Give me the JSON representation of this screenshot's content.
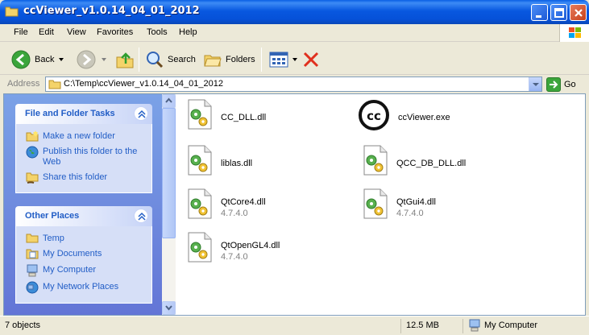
{
  "window": {
    "title": "ccViewer_v1.0.14_04_01_2012"
  },
  "menu": [
    "File",
    "Edit",
    "View",
    "Favorites",
    "Tools",
    "Help"
  ],
  "toolbar": {
    "back": "Back",
    "search": "Search",
    "folders": "Folders"
  },
  "address": {
    "label": "Address",
    "path": "C:\\Temp\\ccViewer_v1.0.14_04_01_2012",
    "go": "Go"
  },
  "tasks": {
    "file_folder": {
      "title": "File and Folder Tasks",
      "items": [
        "Make a new folder",
        "Publish this folder to the Web",
        "Share this folder"
      ]
    },
    "other_places": {
      "title": "Other Places",
      "items": [
        "Temp",
        "My Documents",
        "My Computer",
        "My Network Places"
      ]
    }
  },
  "files": [
    {
      "name": "CC_DLL.dll",
      "version": ""
    },
    {
      "name": "ccViewer.exe",
      "version": ""
    },
    {
      "name": "liblas.dll",
      "version": ""
    },
    {
      "name": "QCC_DB_DLL.dll",
      "version": ""
    },
    {
      "name": "QtCore4.dll",
      "version": "4.7.4.0"
    },
    {
      "name": "QtGui4.dll",
      "version": "4.7.4.0"
    },
    {
      "name": "QtOpenGL4.dll",
      "version": "4.7.4.0"
    }
  ],
  "status": {
    "objects": "7 objects",
    "size": "12.5 MB",
    "location": "My Computer"
  }
}
